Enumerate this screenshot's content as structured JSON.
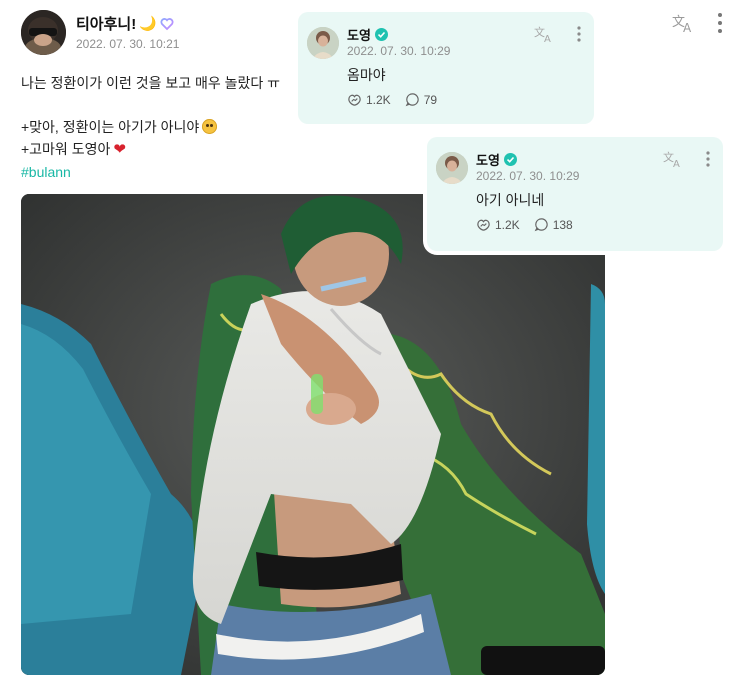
{
  "post": {
    "author": "티아후니!",
    "moon_emoji": "🌙",
    "date": "2022. 07. 30. 10:21",
    "line1": "나는 정환이가 이런 것을 보고 매우 놀랐다 ㅠ",
    "line2": "+맞아, 정환이는 아기가 아니야",
    "line3": "+고마워 도영아",
    "hashtag": "#bulann",
    "heart_emoji": "❤"
  },
  "replies": [
    {
      "author": "도영",
      "date": "2022. 07. 30. 10:29",
      "text": "옴마야",
      "likes": "1.2K",
      "comments": "79"
    },
    {
      "author": "도영",
      "date": "2022. 07. 30. 10:29",
      "text": "아기 아니네",
      "likes": "1.2K",
      "comments": "138"
    }
  ],
  "icons": {
    "translate": "文A",
    "more": "more-vertical-icon",
    "verified": "verified-badge-icon"
  },
  "colors": {
    "card_background": "#e9f8f5",
    "hashtag": "#19b8a5",
    "verified": "#1fc2b0",
    "meta_text": "#8e8e8e"
  }
}
